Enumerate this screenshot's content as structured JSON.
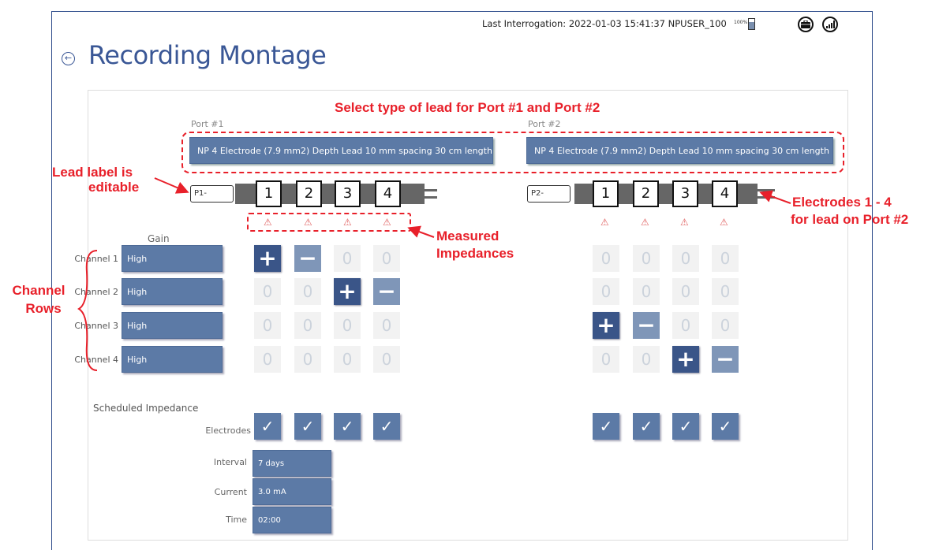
{
  "header": {
    "status_text": "Last Interrogation: 2022-01-03 15:41:37  NPUSER_100",
    "battery_pct": "100%",
    "page_title": "Recording Montage"
  },
  "ports": [
    {
      "label": "Port #1",
      "lead_type": "NP 4 Electrode (7.9 mm2) Depth Lead 10 mm spacing 30 cm length",
      "lead_label": "P1-",
      "electrodes": [
        "1",
        "2",
        "3",
        "4"
      ]
    },
    {
      "label": "Port #2",
      "lead_type": "NP 4 Electrode (7.9 mm2) Depth Lead 10 mm spacing 30 cm length",
      "lead_label": "P2-",
      "electrodes": [
        "1",
        "2",
        "3",
        "4"
      ]
    }
  ],
  "gain_header": "Gain",
  "channels": [
    {
      "label": "Channel 1",
      "gain": "High",
      "p1": [
        "+",
        "−",
        "0",
        "0"
      ],
      "p2": [
        "0",
        "0",
        "0",
        "0"
      ]
    },
    {
      "label": "Channel 2",
      "gain": "High",
      "p1": [
        "0",
        "0",
        "+",
        "−"
      ],
      "p2": [
        "0",
        "0",
        "0",
        "0"
      ]
    },
    {
      "label": "Channel 3",
      "gain": "High",
      "p1": [
        "0",
        "0",
        "0",
        "0"
      ],
      "p2": [
        "+",
        "−",
        "0",
        "0"
      ]
    },
    {
      "label": "Channel 4",
      "gain": "High",
      "p1": [
        "0",
        "0",
        "0",
        "0"
      ],
      "p2": [
        "0",
        "0",
        "+",
        "−"
      ]
    }
  ],
  "scheduled": {
    "title": "Scheduled Impedance",
    "electrodes_label": "Electrodes",
    "interval_label": "Interval",
    "interval_value": "7 days",
    "current_label": "Current",
    "current_value": "3.0 mA",
    "time_label": "Time",
    "time_value": "02:00",
    "check_glyph": "✓"
  },
  "annotations": {
    "select_lead": "Select type of lead for Port #1 and Port #2",
    "lead_label_1": "Lead label is",
    "lead_label_2": "editable",
    "electrodes_1": "Electrodes 1 - 4",
    "electrodes_2": "for lead on Port #2",
    "measured_1": "Measured",
    "measured_2": "Impedances",
    "channel_1": "Channel",
    "channel_2": "Rows"
  },
  "warn_glyph": "⚠",
  "colors": {
    "accent": "#5c7aa6",
    "annotation": "#e8202a",
    "title": "#3a5796"
  }
}
